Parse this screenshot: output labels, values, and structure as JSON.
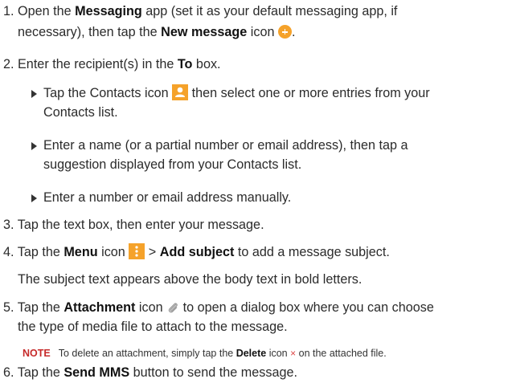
{
  "steps": [
    {
      "num": "1.",
      "p1": " Open the ",
      "b1": "Messaging",
      "p2": " app (set it as your default messaging app, if",
      "line2a": "necessary), then tap the ",
      "line2b": "New message",
      "line2c": " icon ",
      "line2d": "."
    },
    {
      "num": "2.",
      "p1": " Enter the recipient(s) in the ",
      "b1": "To",
      "p2": " box."
    },
    {
      "num": "3.",
      "text": " Tap the text box, then enter your message."
    },
    {
      "num": "4.",
      "p1": " Tap the ",
      "b1": "Menu",
      "p2": " icon ",
      "p3": " > ",
      "b2": "Add subject",
      "p4": " to add a message subject.",
      "sub": "The subject text appears above the body text in bold letters."
    },
    {
      "num": "5.",
      "p1": " Tap the ",
      "b1": "Attachment",
      "p2": " icon ",
      "p3": " to open a dialog box where you can choose",
      "line2": "the type of media file to attach to the message."
    },
    {
      "num": "6.",
      "p1": " Tap the ",
      "b1": "Send MMS",
      "p2": " button to send the message."
    }
  ],
  "bullets": [
    {
      "p1": "Tap the Contacts icon ",
      "p2": " then select one or more entries from your",
      "line2": "Contacts list."
    },
    {
      "line1": "Enter a name (or a partial number or email address), then tap a",
      "line2": "suggestion displayed from your Contacts list."
    },
    {
      "line1": "Enter a number or email address manually."
    }
  ],
  "note": {
    "label": "NOTE",
    "p1": "To delete an attachment, simply tap the ",
    "b1": "Delete",
    "p2": " icon ",
    "x": "×",
    "p3": " on the attached file."
  },
  "colors": {
    "accent_orange": "#f5a22a",
    "note_red": "#c62a2a"
  },
  "icons": [
    "new-message-icon",
    "contacts-icon",
    "menu-icon",
    "attachment-icon",
    "delete-icon"
  ]
}
